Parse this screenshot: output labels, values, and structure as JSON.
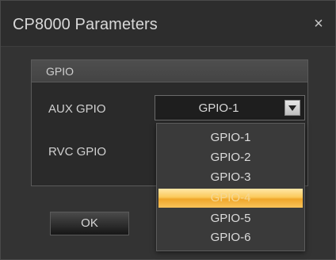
{
  "window": {
    "title": "CP8000 Parameters",
    "close_glyph": "×"
  },
  "group": {
    "title": "GPIO",
    "aux_label": "AUX GPIO",
    "rvc_label": "RVC GPIO"
  },
  "combo": {
    "value": "GPIO-1"
  },
  "dropdown": {
    "options": [
      "GPIO-1",
      "GPIO-2",
      "GPIO-3",
      "GPIO-4",
      "GPIO-5",
      "GPIO-6"
    ],
    "highlighted_index": 3
  },
  "buttons": {
    "ok": "OK"
  },
  "colors": {
    "dialog_bg": "#333333",
    "highlight": "#fbc95a"
  }
}
